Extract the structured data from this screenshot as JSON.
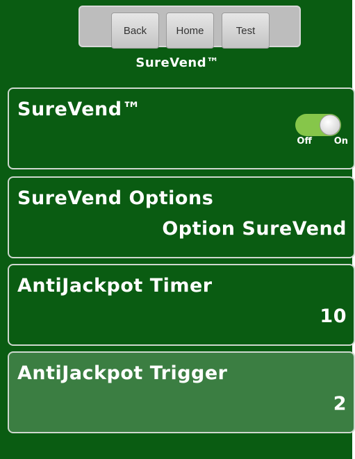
{
  "nav": {
    "back_label": "Back",
    "home_label": "Home",
    "test_label": "Test"
  },
  "header": {
    "title": "SureVend™"
  },
  "settings": [
    {
      "label": "SureVend™",
      "control": "toggle",
      "toggle_state": "On",
      "toggle_off_label": "Off",
      "toggle_on_label": "On"
    },
    {
      "label": "SureVend Options",
      "value": "Option SureVend"
    },
    {
      "label": "AntiJackpot Timer",
      "value": "10"
    },
    {
      "label": "AntiJackpot Trigger",
      "value": "2",
      "selected": true
    }
  ],
  "colors": {
    "background": "#0a5c12",
    "selected_row": "#3b7e42",
    "toggle_track_on": "#86c64a",
    "nav_bar": "#bdbdbd"
  }
}
